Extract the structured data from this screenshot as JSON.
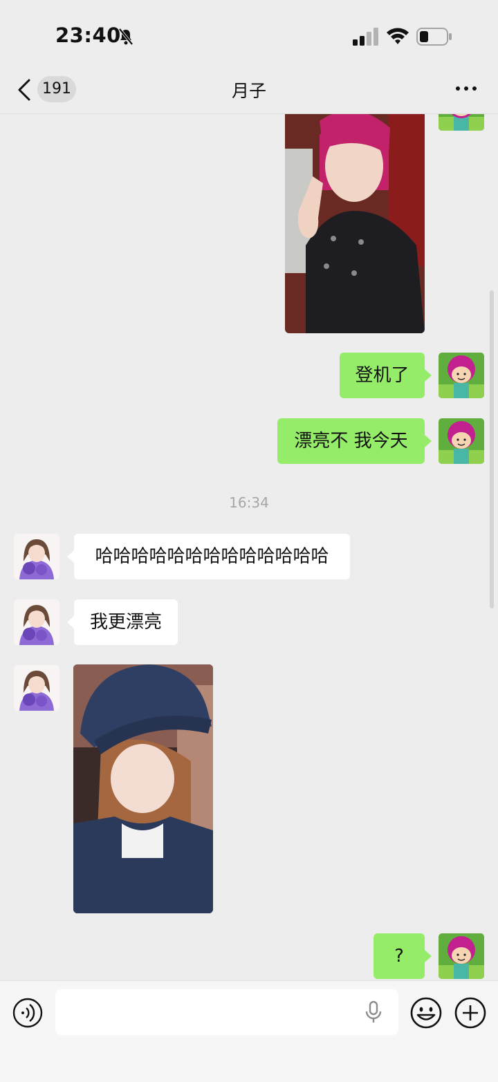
{
  "status_bar": {
    "time": "23:40"
  },
  "nav": {
    "unread_count": "191",
    "title": "月子"
  },
  "messages": [
    {
      "side": "me",
      "kind": "photo"
    },
    {
      "side": "me",
      "kind": "text",
      "text": "登机了"
    },
    {
      "side": "me",
      "kind": "text",
      "text": "漂亮不 我今天"
    },
    {
      "kind": "timestamp",
      "text": "16:34"
    },
    {
      "side": "other",
      "kind": "text",
      "text": "哈哈哈哈哈哈哈哈哈哈哈哈哈"
    },
    {
      "side": "other",
      "kind": "text",
      "text": "我更漂亮"
    },
    {
      "side": "other",
      "kind": "photo"
    },
    {
      "side": "me",
      "kind": "text",
      "text": "?"
    }
  ],
  "colors": {
    "my_bubble": "#95ec69",
    "their_bubble": "#ffffff",
    "background": "#ededed"
  }
}
